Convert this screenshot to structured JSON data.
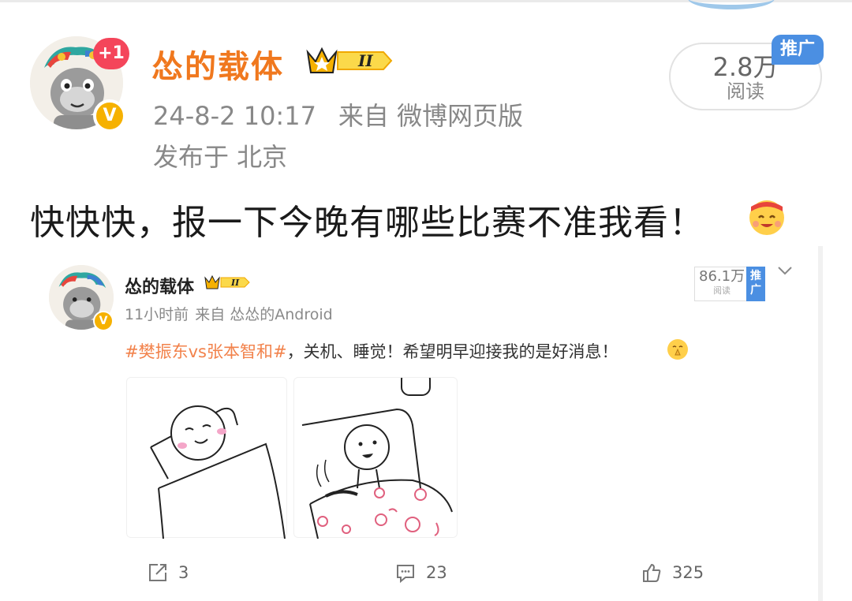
{
  "post": {
    "author": "怂的载体",
    "rank_badge": "II",
    "notification_badge": "+1",
    "verified_badge": "V",
    "timestamp": "24-8-2 10:17",
    "source": "来自 微博网页版",
    "location": "发布于 北京",
    "read_count": "2.8万",
    "read_label": "阅读",
    "promo_tag": "推广",
    "text": "快快快，报一下今晚有哪些比赛不准我看！",
    "emoji_icon": "cheering-face-emoji"
  },
  "embedded_post": {
    "author": "怂的载体",
    "rank_badge": "II",
    "verified_badge": "V",
    "time": "11小时前",
    "source": "来自 怂怂的Android",
    "read_count": "86.1万",
    "read_label": "阅读",
    "promo_tag": "推广",
    "hashtag": "#樊振东vs张本智和#",
    "text": "，关机、睡觉！希望明早迎接我的是好消息！",
    "emoji_icon": "praying-face-emoji",
    "images": [
      "sleeping-character-image",
      "waking-character-image"
    ],
    "actions": {
      "repost": "3",
      "comment": "23",
      "like": "325"
    }
  },
  "colors": {
    "username": "#f0781e",
    "hashtag": "#f2824b",
    "promo_blue": "#4b8fe2",
    "badge_red": "#f4455a",
    "badge_gold": "#f6b100"
  }
}
